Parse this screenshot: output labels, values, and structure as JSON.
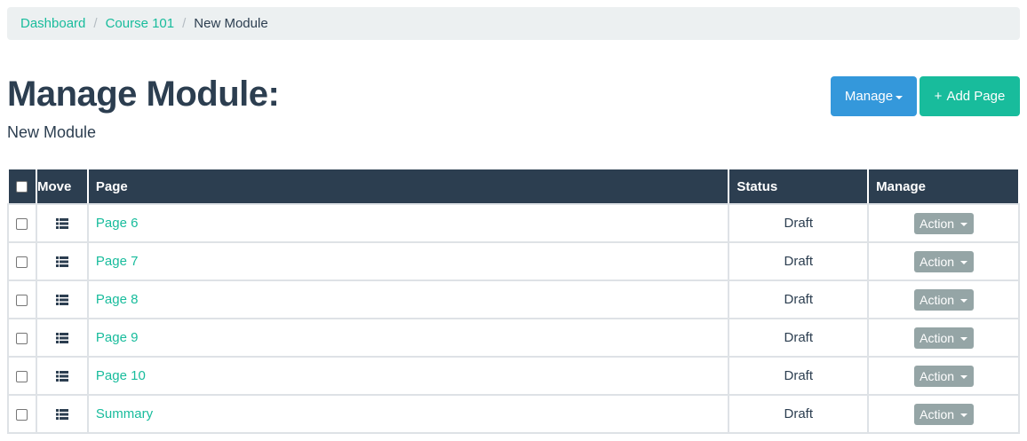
{
  "breadcrumb": {
    "items": [
      {
        "label": "Dashboard"
      },
      {
        "label": "Course 101"
      }
    ],
    "current": "New Module",
    "separator": "/"
  },
  "header": {
    "title": "Manage Module:",
    "subtitle": "New Module"
  },
  "toolbar": {
    "manage_label": "Manage",
    "add_label": "Add Page",
    "add_icon": "plus-icon"
  },
  "table": {
    "columns": {
      "move": "Move",
      "page": "Page",
      "status": "Status",
      "manage": "Manage"
    },
    "rows": [
      {
        "page": "Page 6",
        "status": "Draft",
        "action": "Action"
      },
      {
        "page": "Page 7",
        "status": "Draft",
        "action": "Action"
      },
      {
        "page": "Page 8",
        "status": "Draft",
        "action": "Action"
      },
      {
        "page": "Page 9",
        "status": "Draft",
        "action": "Action"
      },
      {
        "page": "Page 10",
        "status": "Draft",
        "action": "Action"
      },
      {
        "page": "Summary",
        "status": "Draft",
        "action": "Action"
      }
    ]
  },
  "colors": {
    "primary": "#2c3e50",
    "success": "#18bc9c",
    "info": "#3498db",
    "muted": "#95a5a6"
  }
}
